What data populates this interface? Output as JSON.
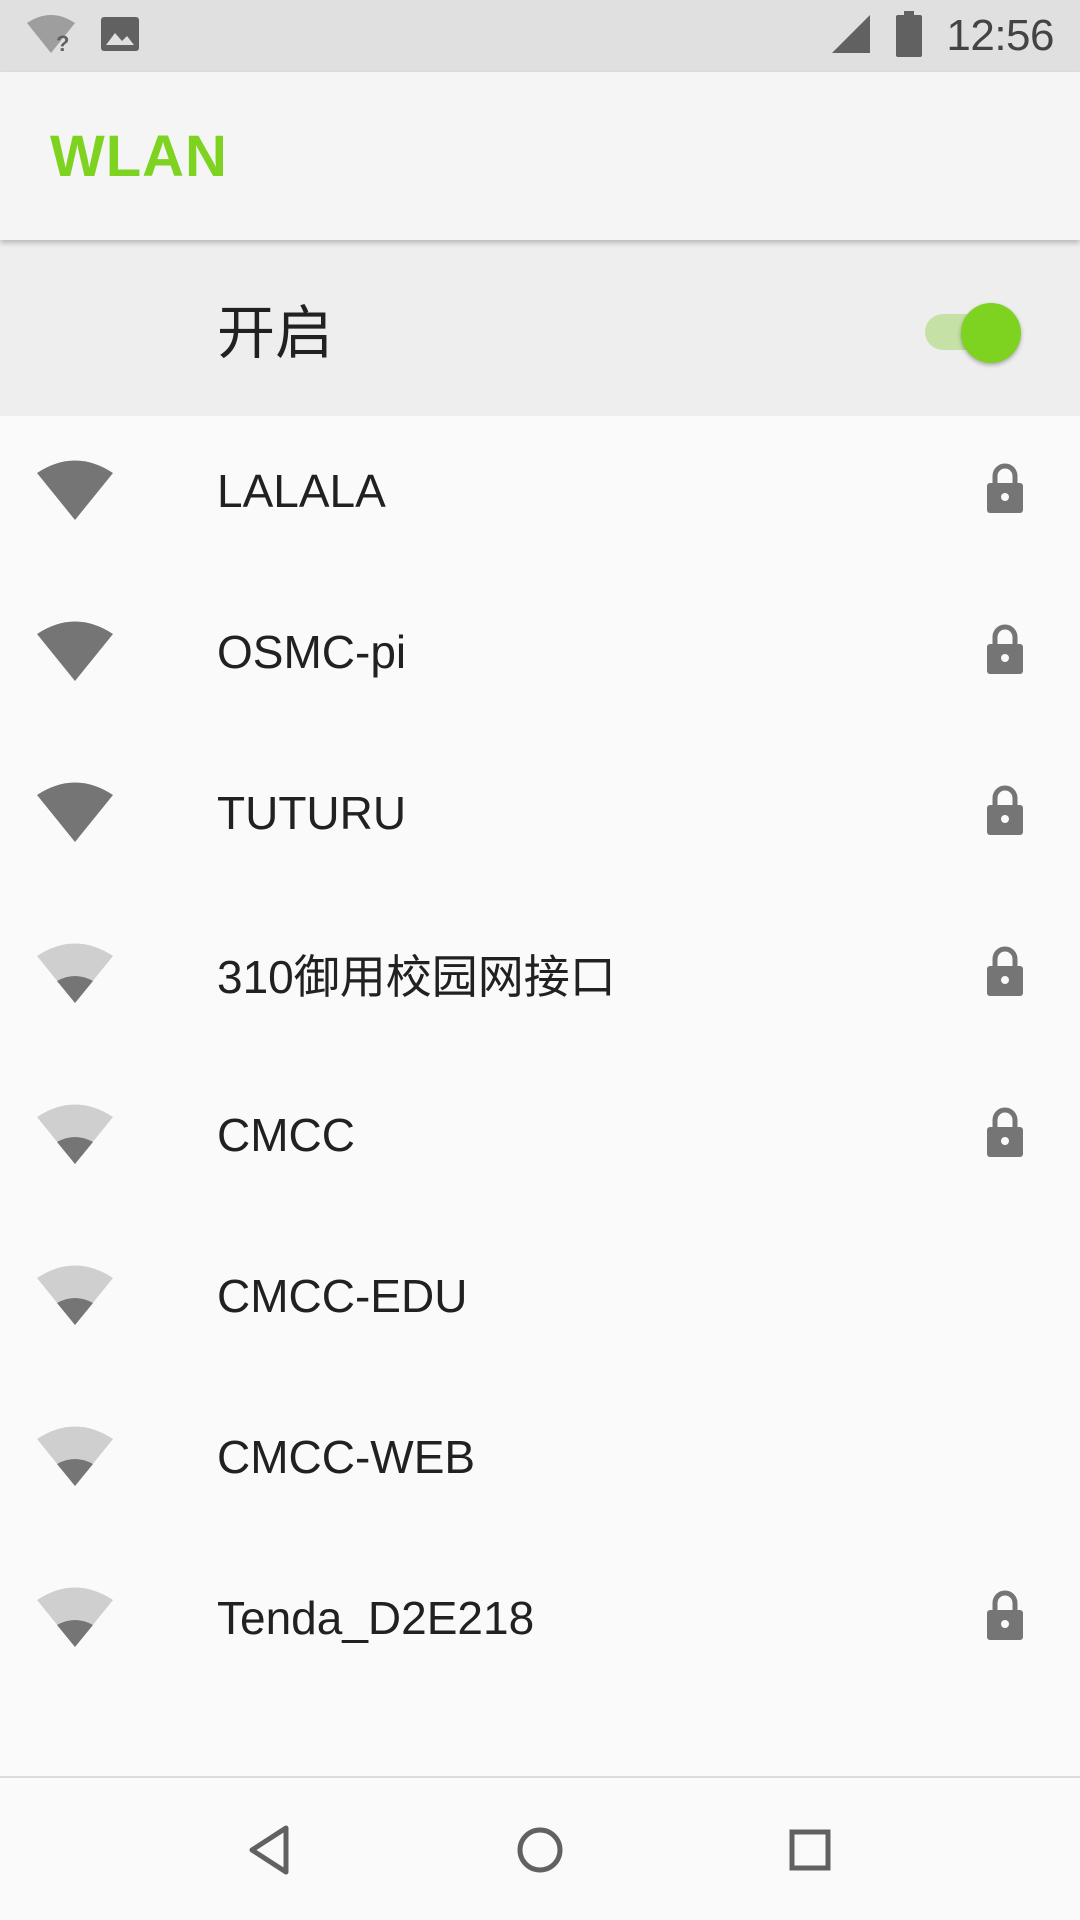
{
  "status_bar": {
    "time": "12:56",
    "icons": [
      "wifi-unknown-icon",
      "image-notification-icon",
      "cell-signal-icon",
      "battery-icon"
    ]
  },
  "app_bar": {
    "title": "WLAN"
  },
  "master_switch": {
    "label": "开启",
    "state": "on",
    "accent_color": "#7ed321"
  },
  "networks": [
    {
      "ssid": "LALALA",
      "signal": "strong",
      "secured": true
    },
    {
      "ssid": "OSMC-pi",
      "signal": "strong",
      "secured": true
    },
    {
      "ssid": "TUTURU",
      "signal": "strong",
      "secured": true
    },
    {
      "ssid": "310御用校园网接口",
      "signal": "weak",
      "secured": true
    },
    {
      "ssid": "CMCC",
      "signal": "weak",
      "secured": true
    },
    {
      "ssid": "CMCC-EDU",
      "signal": "weak",
      "secured": false
    },
    {
      "ssid": "CMCC-WEB",
      "signal": "weak",
      "secured": false
    },
    {
      "ssid": "Tenda_D2E218",
      "signal": "weak",
      "secured": true
    }
  ],
  "nav_bar": {
    "buttons": [
      "back-icon",
      "home-icon",
      "recents-icon"
    ]
  }
}
